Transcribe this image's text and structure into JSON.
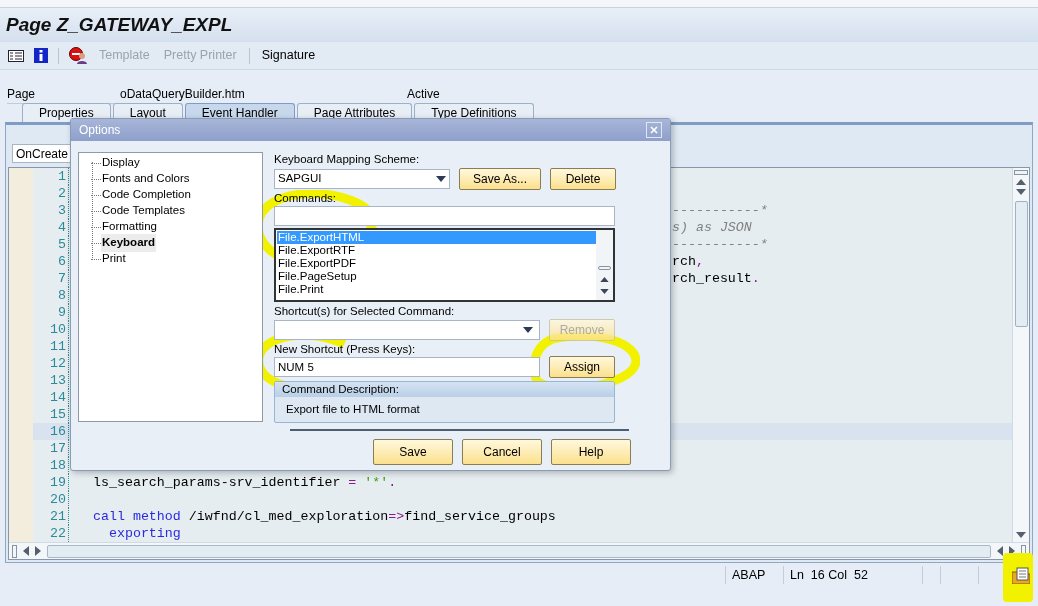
{
  "title": "Page Z_GATEWAY_EXPL",
  "toolbar": [
    {
      "label": "Template",
      "disabled": true
    },
    {
      "label": "Pretty Printer",
      "disabled": true
    },
    {
      "label": "Signature",
      "disabled": false
    }
  ],
  "header": {
    "label": "Page",
    "value": "oDataQueryBuilder.htm",
    "status": "Active"
  },
  "tabs": [
    {
      "label": "Properties",
      "selected": false
    },
    {
      "label": "Layout",
      "selected": false
    },
    {
      "label": "Event Handler",
      "selected": true
    },
    {
      "label": "Page Attributes",
      "selected": false
    },
    {
      "label": "Type Definitions",
      "selected": false
    }
  ],
  "event_select": {
    "value": "OnCreate"
  },
  "editor": {
    "lines": [
      {
        "number": "1",
        "current": false
      },
      {
        "number": "2",
        "current": false
      },
      {
        "number": "3",
        "current": false,
        "visible_tail": [
          {
            "kind": "comment",
            "text": "-----------*"
          }
        ]
      },
      {
        "number": "4",
        "current": false,
        "visible_tail": [
          {
            "kind": "comment",
            "text": "s) as JSON"
          }
        ]
      },
      {
        "number": "5",
        "current": false,
        "visible_tail": [
          {
            "kind": "comment",
            "text": "-----------*"
          }
        ]
      },
      {
        "number": "6",
        "current": false,
        "visible_tail": [
          {
            "kind": "plain",
            "text": "rch"
          },
          {
            "kind": "operator",
            "text": ","
          }
        ]
      },
      {
        "number": "7",
        "current": false,
        "visible_tail": [
          {
            "kind": "plain",
            "text": "rch_result"
          },
          {
            "kind": "operator",
            "text": "."
          }
        ]
      },
      {
        "number": "8",
        "current": false
      },
      {
        "number": "9",
        "current": false
      },
      {
        "number": "10",
        "current": false
      },
      {
        "number": "11",
        "current": false
      },
      {
        "number": "12",
        "current": false
      },
      {
        "number": "13",
        "current": false
      },
      {
        "number": "14",
        "current": false
      },
      {
        "number": "15",
        "current": false
      },
      {
        "number": "16",
        "current": true
      },
      {
        "number": "17",
        "current": false
      },
      {
        "number": "18",
        "current": false
      },
      {
        "number": "19",
        "current": false,
        "tokens": [
          {
            "kind": "plain",
            "text": "ls_search_params-srv_identifier "
          },
          {
            "kind": "operator",
            "text": "= "
          },
          {
            "kind": "string",
            "text": "'*'"
          },
          {
            "kind": "operator",
            "text": "."
          }
        ]
      },
      {
        "number": "20",
        "current": false
      },
      {
        "number": "21",
        "current": false,
        "tokens": [
          {
            "kind": "keyword",
            "text": "call method"
          },
          {
            "kind": "plain",
            "text": " /iwfnd/cl_med_exploration"
          },
          {
            "kind": "operator",
            "text": "=>"
          },
          {
            "kind": "plain",
            "text": "find_service_groups"
          }
        ]
      },
      {
        "number": "22",
        "current": false,
        "tokens": [
          {
            "kind": "keyword",
            "text": "  exporting"
          }
        ]
      }
    ]
  },
  "status_bar": {
    "language": "ABAP",
    "position": "Ln  16 Col  52"
  },
  "dialog": {
    "title": "Options",
    "tree": [
      {
        "label": "Display",
        "selected": false
      },
      {
        "label": "Fonts and Colors",
        "selected": false
      },
      {
        "label": "Code Completion",
        "selected": false
      },
      {
        "label": "Code Templates",
        "selected": false
      },
      {
        "label": "Formatting",
        "selected": false
      },
      {
        "label": "Keyboard",
        "selected": true
      },
      {
        "label": "Print",
        "selected": false
      }
    ],
    "scheme_label": "Keyboard Mapping Scheme:",
    "scheme_value": "SAPGUI",
    "save_as": {
      "label": "Save As...",
      "disabled": false
    },
    "delete": {
      "label": "Delete",
      "disabled": false
    },
    "commands_label": "Commands:",
    "commands": [
      {
        "label": "File.ExportHTML",
        "selected": true
      },
      {
        "label": "File.ExportRTF",
        "selected": false
      },
      {
        "label": "File.ExportPDF",
        "selected": false
      },
      {
        "label": "File.PageSetup",
        "selected": false
      },
      {
        "label": "File.Print",
        "selected": false
      }
    ],
    "shortcuts_label": "Shortcut(s) for Selected Command:",
    "remove": {
      "label": "Remove",
      "disabled": true
    },
    "new_shortcut_label": "New Shortcut (Press Keys):",
    "new_shortcut_value": "NUM 5",
    "assign": {
      "label": "Assign",
      "disabled": false
    },
    "description_label": "Command Description:",
    "description": "Export file to HTML format",
    "buttons": [
      "Save",
      "Cancel",
      "Help"
    ]
  }
}
